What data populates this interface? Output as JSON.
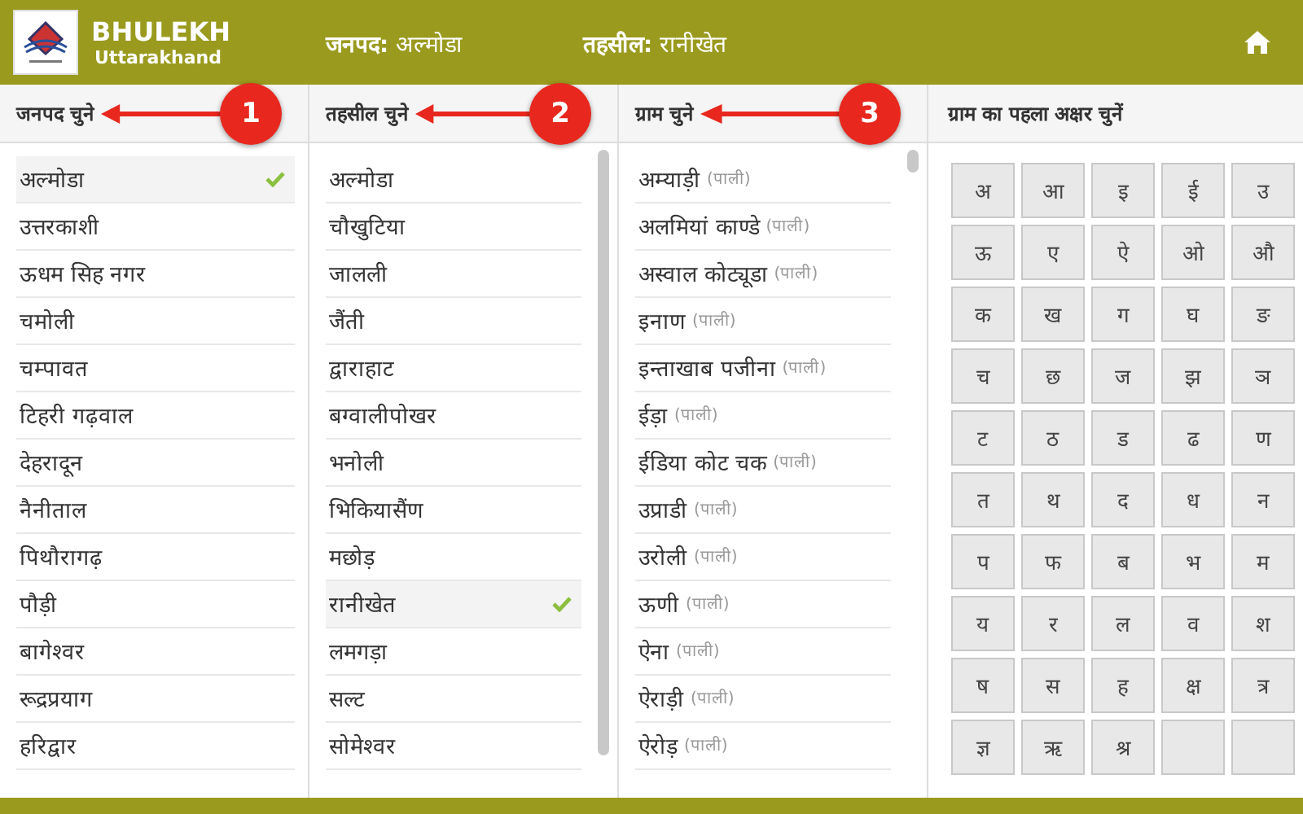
{
  "header": {
    "brand": "BHULEKH",
    "subtitle": "Uttarakhand",
    "district": {
      "label": "जनपद:",
      "value": "अल्मोडा"
    },
    "tehsil": {
      "label": "तहसील:",
      "value": "रानीखेत"
    }
  },
  "columns": [
    {
      "heading": "जनपद चुने",
      "callout": "1",
      "scrollbar": false,
      "items": [
        {
          "name": "अल्मोडा",
          "selected": true
        },
        {
          "name": "उत्तरकाशी",
          "selected": false
        },
        {
          "name": "ऊधम सिह नगर",
          "selected": false
        },
        {
          "name": "चमोली",
          "selected": false
        },
        {
          "name": "चम्पावत",
          "selected": false
        },
        {
          "name": "टिहरी गढ़वाल",
          "selected": false
        },
        {
          "name": "देहरादून",
          "selected": false
        },
        {
          "name": "नैनीताल",
          "selected": false
        },
        {
          "name": "पिथौरागढ़",
          "selected": false
        },
        {
          "name": "पौड़ी",
          "selected": false
        },
        {
          "name": "बागेश्वर",
          "selected": false
        },
        {
          "name": "रूद्रप्रयाग",
          "selected": false
        },
        {
          "name": "हरिद्वार",
          "selected": false
        }
      ]
    },
    {
      "heading": "तहसील चुने",
      "callout": "2",
      "scrollbar": true,
      "items": [
        {
          "name": "अल्मोडा",
          "selected": false
        },
        {
          "name": "चौखुटिया",
          "selected": false
        },
        {
          "name": "जालली",
          "selected": false
        },
        {
          "name": "जैंती",
          "selected": false
        },
        {
          "name": "द्वाराहाट",
          "selected": false
        },
        {
          "name": "बग्वालीपोखर",
          "selected": false
        },
        {
          "name": "भनोली",
          "selected": false
        },
        {
          "name": "भिकियासैंण",
          "selected": false
        },
        {
          "name": "मछोड़",
          "selected": false
        },
        {
          "name": "रानीखेत",
          "selected": true
        },
        {
          "name": "लमगड़ा",
          "selected": false
        },
        {
          "name": "सल्ट",
          "selected": false
        },
        {
          "name": "सोमेश्वर",
          "selected": false
        }
      ]
    },
    {
      "heading": "ग्राम चुने",
      "callout": "3",
      "scrollbar": true,
      "items": [
        {
          "name": "अम्याड़ी",
          "tag": "(पाली)",
          "selected": false
        },
        {
          "name": "अलमियां काण्डे",
          "tag": "(पाली)",
          "selected": false
        },
        {
          "name": "अस्वाल कोट्यूडा",
          "tag": "(पाली)",
          "selected": false
        },
        {
          "name": "इनाण",
          "tag": "(पाली)",
          "selected": false
        },
        {
          "name": "इन्ताखाब पजीना",
          "tag": "(पाली)",
          "selected": false
        },
        {
          "name": "ईड़ा",
          "tag": "(पाली)",
          "selected": false
        },
        {
          "name": "ईडिया कोट चक",
          "tag": "(पाली)",
          "selected": false
        },
        {
          "name": "उप्राडी",
          "tag": "(पाली)",
          "selected": false
        },
        {
          "name": "उरोली",
          "tag": "(पाली)",
          "selected": false
        },
        {
          "name": "ऊणी",
          "tag": "(पाली)",
          "selected": false
        },
        {
          "name": "ऐना",
          "tag": "(पाली)",
          "selected": false
        },
        {
          "name": "ऐराड़ी",
          "tag": "(पाली)",
          "selected": false
        },
        {
          "name": "ऐरोड़",
          "tag": "(पाली)",
          "selected": false
        }
      ]
    }
  ],
  "letters": {
    "heading": "ग्राम का पहला अक्षर चुनें",
    "keys": [
      "अ",
      "आ",
      "इ",
      "ई",
      "उ",
      "ऊ",
      "ए",
      "ऐ",
      "ओ",
      "औ",
      "क",
      "ख",
      "ग",
      "घ",
      "ङ",
      "च",
      "छ",
      "ज",
      "झ",
      "ञ",
      "ट",
      "ठ",
      "ड",
      "ढ",
      "ण",
      "त",
      "थ",
      "द",
      "ध",
      "न",
      "प",
      "फ",
      "ब",
      "भ",
      "म",
      "य",
      "र",
      "ल",
      "व",
      "श",
      "ष",
      "स",
      "ह",
      "क्ष",
      "त्र",
      "ज्ञ",
      "ऋ",
      "श्र"
    ]
  }
}
